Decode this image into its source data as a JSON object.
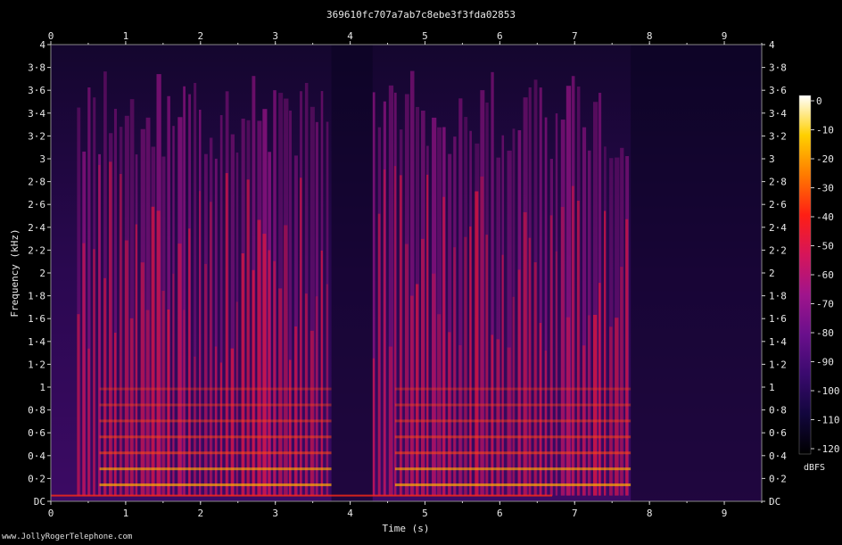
{
  "footer_text": "www.JollyRogerTelephone.com",
  "chart_data": {
    "type": "heatmap",
    "title": "369610fc707a7ab7c8ebe3f3fda02853",
    "xlabel": "Time (s)",
    "ylabel": "Frequency (kHz)",
    "xlim": [
      0,
      9.5
    ],
    "ylim": [
      0,
      4
    ],
    "x_ticks": [
      "0",
      "1",
      "2",
      "3",
      "4",
      "5",
      "6",
      "7",
      "8",
      "9"
    ],
    "y_ticks": [
      "DC",
      "0·2",
      "0·4",
      "0·6",
      "0·8",
      "1",
      "1·2",
      "1·4",
      "1·6",
      "1·8",
      "2",
      "2·2",
      "2·4",
      "2·6",
      "2·8",
      "3",
      "3·2",
      "3·4",
      "3·6",
      "3·8",
      "4"
    ],
    "colorbar": {
      "label": "dBFS",
      "ticks": [
        "0",
        "-10",
        "-20",
        "-30",
        "-40",
        "-50",
        "-60",
        "-70",
        "-80",
        "-90",
        "-100",
        "-110",
        "-120"
      ],
      "range": [
        -120,
        0
      ],
      "colors": [
        "#000000",
        "#12063d",
        "#3a0a6e",
        "#6a0f8c",
        "#a0148c",
        "#d6155a",
        "#ff1e14",
        "#ff7a00",
        "#ffd000",
        "#ffffff"
      ]
    },
    "speech_segments_s": [
      [
        0.35,
        3.75
      ],
      [
        4.3,
        7.75
      ]
    ],
    "silence_segments_s": [
      [
        3.75,
        4.3
      ],
      [
        7.75,
        9.5
      ]
    ]
  }
}
